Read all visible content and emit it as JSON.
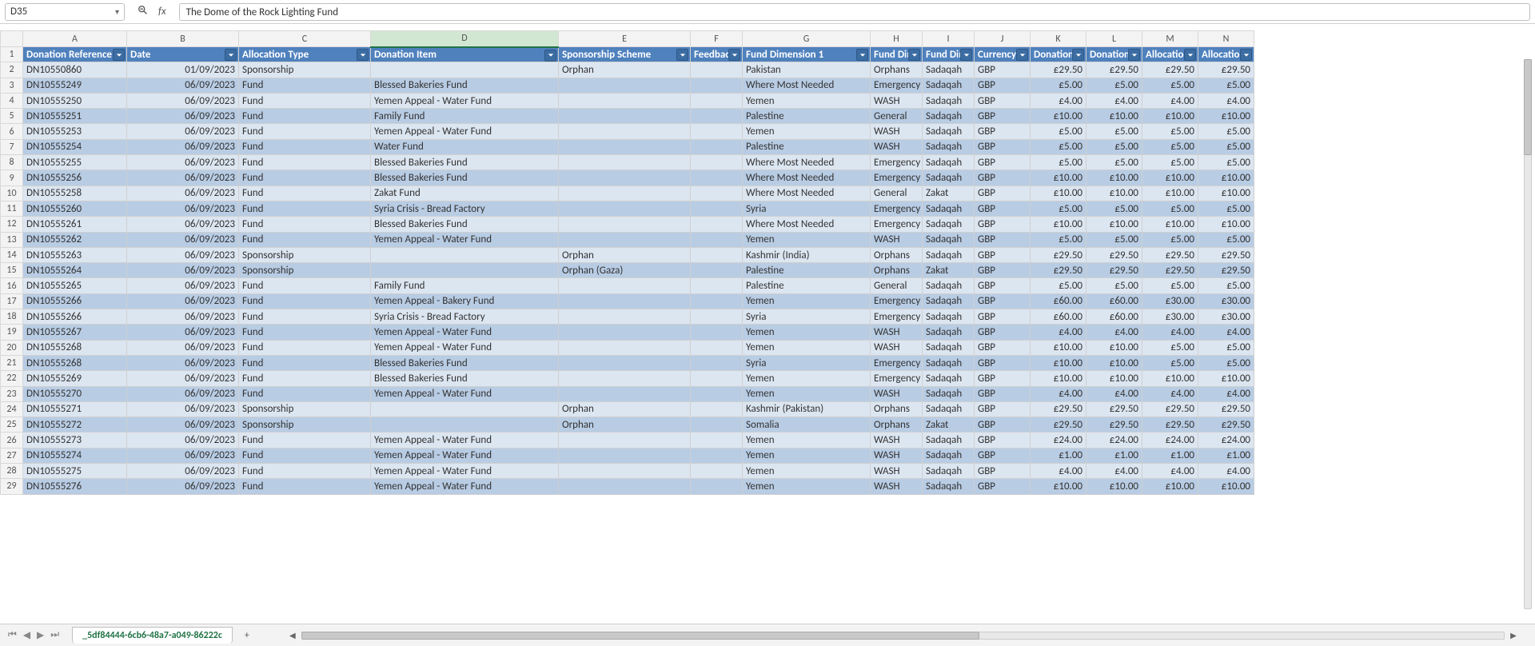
{
  "nameBox": {
    "cellRef": "D35"
  },
  "formulaBar": {
    "value": "The Dome of the Rock Lighting Fund"
  },
  "sheetTab": {
    "name": "_5df84444-6cb6-48a7-a049-86222c"
  },
  "columns": {
    "letters": [
      "A",
      "B",
      "C",
      "D",
      "E",
      "F",
      "G",
      "H",
      "I",
      "J",
      "K",
      "L",
      "M",
      "N"
    ],
    "widths": [
      130,
      140,
      165,
      235,
      165,
      65,
      160,
      65,
      65,
      70,
      70,
      70,
      70,
      70
    ],
    "selectedIndex": 3
  },
  "headers": [
    "Donation Reference",
    "Date",
    "Allocation Type",
    "Donation Item",
    "Sponsorship Scheme",
    "Feedback",
    "Fund Dimension 1",
    "Fund Dim",
    "Fund Dim",
    "Currency",
    "Donation",
    "Donation",
    "Allocation",
    "Allocation"
  ],
  "rows": [
    {
      "ref": "DN10550860",
      "date": "01/09/2023",
      "alloc": "Sponsorship",
      "item": "",
      "scheme": "Orphan",
      "fb": "",
      "fd1": "Pakistan",
      "fd2": "Orphans",
      "fd3": "Sadaqah",
      "cur": "GBP",
      "d1": "£29.50",
      "d2": "£29.50",
      "a1": "£29.50",
      "a2": "£29.50"
    },
    {
      "ref": "DN10555249",
      "date": "06/09/2023",
      "alloc": "Fund",
      "item": "Blessed Bakeries Fund",
      "scheme": "",
      "fb": "",
      "fd1": "Where Most Needed",
      "fd2": "Emergency",
      "fd3": "Sadaqah",
      "cur": "GBP",
      "d1": "£5.00",
      "d2": "£5.00",
      "a1": "£5.00",
      "a2": "£5.00"
    },
    {
      "ref": "DN10555250",
      "date": "06/09/2023",
      "alloc": "Fund",
      "item": "Yemen Appeal - Water Fund",
      "scheme": "",
      "fb": "",
      "fd1": "Yemen",
      "fd2": "WASH",
      "fd3": "Sadaqah",
      "cur": "GBP",
      "d1": "£4.00",
      "d2": "£4.00",
      "a1": "£4.00",
      "a2": "£4.00"
    },
    {
      "ref": "DN10555251",
      "date": "06/09/2023",
      "alloc": "Fund",
      "item": "Family Fund",
      "scheme": "",
      "fb": "",
      "fd1": "Palestine",
      "fd2": "General",
      "fd3": "Sadaqah",
      "cur": "GBP",
      "d1": "£10.00",
      "d2": "£10.00",
      "a1": "£10.00",
      "a2": "£10.00"
    },
    {
      "ref": "DN10555253",
      "date": "06/09/2023",
      "alloc": "Fund",
      "item": "Yemen Appeal - Water Fund",
      "scheme": "",
      "fb": "",
      "fd1": "Yemen",
      "fd2": "WASH",
      "fd3": "Sadaqah",
      "cur": "GBP",
      "d1": "£5.00",
      "d2": "£5.00",
      "a1": "£5.00",
      "a2": "£5.00"
    },
    {
      "ref": "DN10555254",
      "date": "06/09/2023",
      "alloc": "Fund",
      "item": "Water Fund",
      "scheme": "",
      "fb": "",
      "fd1": "Palestine",
      "fd2": "WASH",
      "fd3": "Sadaqah",
      "cur": "GBP",
      "d1": "£5.00",
      "d2": "£5.00",
      "a1": "£5.00",
      "a2": "£5.00"
    },
    {
      "ref": "DN10555255",
      "date": "06/09/2023",
      "alloc": "Fund",
      "item": "Blessed Bakeries Fund",
      "scheme": "",
      "fb": "",
      "fd1": "Where Most Needed",
      "fd2": "Emergency",
      "fd3": "Sadaqah",
      "cur": "GBP",
      "d1": "£5.00",
      "d2": "£5.00",
      "a1": "£5.00",
      "a2": "£5.00"
    },
    {
      "ref": "DN10555256",
      "date": "06/09/2023",
      "alloc": "Fund",
      "item": "Blessed Bakeries Fund",
      "scheme": "",
      "fb": "",
      "fd1": "Where Most Needed",
      "fd2": "Emergency",
      "fd3": "Sadaqah",
      "cur": "GBP",
      "d1": "£10.00",
      "d2": "£10.00",
      "a1": "£10.00",
      "a2": "£10.00"
    },
    {
      "ref": "DN10555258",
      "date": "06/09/2023",
      "alloc": "Fund",
      "item": "Zakat Fund",
      "scheme": "",
      "fb": "",
      "fd1": "Where Most Needed",
      "fd2": "General",
      "fd3": "Zakat",
      "cur": "GBP",
      "d1": "£10.00",
      "d2": "£10.00",
      "a1": "£10.00",
      "a2": "£10.00"
    },
    {
      "ref": "DN10555260",
      "date": "06/09/2023",
      "alloc": "Fund",
      "item": "Syria Crisis - Bread Factory",
      "scheme": "",
      "fb": "",
      "fd1": "Syria",
      "fd2": "Emergency",
      "fd3": "Sadaqah",
      "cur": "GBP",
      "d1": "£5.00",
      "d2": "£5.00",
      "a1": "£5.00",
      "a2": "£5.00"
    },
    {
      "ref": "DN10555261",
      "date": "06/09/2023",
      "alloc": "Fund",
      "item": "Blessed Bakeries Fund",
      "scheme": "",
      "fb": "",
      "fd1": "Where Most Needed",
      "fd2": "Emergency",
      "fd3": "Sadaqah",
      "cur": "GBP",
      "d1": "£10.00",
      "d2": "£10.00",
      "a1": "£10.00",
      "a2": "£10.00"
    },
    {
      "ref": "DN10555262",
      "date": "06/09/2023",
      "alloc": "Fund",
      "item": "Yemen Appeal - Water Fund",
      "scheme": "",
      "fb": "",
      "fd1": "Yemen",
      "fd2": "WASH",
      "fd3": "Sadaqah",
      "cur": "GBP",
      "d1": "£5.00",
      "d2": "£5.00",
      "a1": "£5.00",
      "a2": "£5.00"
    },
    {
      "ref": "DN10555263",
      "date": "06/09/2023",
      "alloc": "Sponsorship",
      "item": "",
      "scheme": "Orphan",
      "fb": "",
      "fd1": "Kashmir (India)",
      "fd2": "Orphans",
      "fd3": "Sadaqah",
      "cur": "GBP",
      "d1": "£29.50",
      "d2": "£29.50",
      "a1": "£29.50",
      "a2": "£29.50"
    },
    {
      "ref": "DN10555264",
      "date": "06/09/2023",
      "alloc": "Sponsorship",
      "item": "",
      "scheme": "Orphan (Gaza)",
      "fb": "",
      "fd1": "Palestine",
      "fd2": "Orphans",
      "fd3": "Zakat",
      "cur": "GBP",
      "d1": "£29.50",
      "d2": "£29.50",
      "a1": "£29.50",
      "a2": "£29.50"
    },
    {
      "ref": "DN10555265",
      "date": "06/09/2023",
      "alloc": "Fund",
      "item": "Family Fund",
      "scheme": "",
      "fb": "",
      "fd1": "Palestine",
      "fd2": "General",
      "fd3": "Sadaqah",
      "cur": "GBP",
      "d1": "£5.00",
      "d2": "£5.00",
      "a1": "£5.00",
      "a2": "£5.00"
    },
    {
      "ref": "DN10555266",
      "date": "06/09/2023",
      "alloc": "Fund",
      "item": "Yemen Appeal - Bakery Fund",
      "scheme": "",
      "fb": "",
      "fd1": "Yemen",
      "fd2": "Emergency",
      "fd3": "Sadaqah",
      "cur": "GBP",
      "d1": "£60.00",
      "d2": "£60.00",
      "a1": "£30.00",
      "a2": "£30.00"
    },
    {
      "ref": "DN10555266",
      "date": "06/09/2023",
      "alloc": "Fund",
      "item": "Syria Crisis - Bread Factory",
      "scheme": "",
      "fb": "",
      "fd1": "Syria",
      "fd2": "Emergency",
      "fd3": "Sadaqah",
      "cur": "GBP",
      "d1": "£60.00",
      "d2": "£60.00",
      "a1": "£30.00",
      "a2": "£30.00"
    },
    {
      "ref": "DN10555267",
      "date": "06/09/2023",
      "alloc": "Fund",
      "item": "Yemen Appeal - Water Fund",
      "scheme": "",
      "fb": "",
      "fd1": "Yemen",
      "fd2": "WASH",
      "fd3": "Sadaqah",
      "cur": "GBP",
      "d1": "£4.00",
      "d2": "£4.00",
      "a1": "£4.00",
      "a2": "£4.00"
    },
    {
      "ref": "DN10555268",
      "date": "06/09/2023",
      "alloc": "Fund",
      "item": "Yemen Appeal - Water Fund",
      "scheme": "",
      "fb": "",
      "fd1": "Yemen",
      "fd2": "WASH",
      "fd3": "Sadaqah",
      "cur": "GBP",
      "d1": "£10.00",
      "d2": "£10.00",
      "a1": "£5.00",
      "a2": "£5.00"
    },
    {
      "ref": "DN10555268",
      "date": "06/09/2023",
      "alloc": "Fund",
      "item": "Blessed Bakeries Fund",
      "scheme": "",
      "fb": "",
      "fd1": "Syria",
      "fd2": "Emergency",
      "fd3": "Sadaqah",
      "cur": "GBP",
      "d1": "£10.00",
      "d2": "£10.00",
      "a1": "£5.00",
      "a2": "£5.00"
    },
    {
      "ref": "DN10555269",
      "date": "06/09/2023",
      "alloc": "Fund",
      "item": "Blessed Bakeries Fund",
      "scheme": "",
      "fb": "",
      "fd1": "Yemen",
      "fd2": "Emergency",
      "fd3": "Sadaqah",
      "cur": "GBP",
      "d1": "£10.00",
      "d2": "£10.00",
      "a1": "£10.00",
      "a2": "£10.00"
    },
    {
      "ref": "DN10555270",
      "date": "06/09/2023",
      "alloc": "Fund",
      "item": "Yemen Appeal - Water Fund",
      "scheme": "",
      "fb": "",
      "fd1": "Yemen",
      "fd2": "WASH",
      "fd3": "Sadaqah",
      "cur": "GBP",
      "d1": "£4.00",
      "d2": "£4.00",
      "a1": "£4.00",
      "a2": "£4.00"
    },
    {
      "ref": "DN10555271",
      "date": "06/09/2023",
      "alloc": "Sponsorship",
      "item": "",
      "scheme": "Orphan",
      "fb": "",
      "fd1": "Kashmir (Pakistan)",
      "fd2": "Orphans",
      "fd3": "Sadaqah",
      "cur": "GBP",
      "d1": "£29.50",
      "d2": "£29.50",
      "a1": "£29.50",
      "a2": "£29.50"
    },
    {
      "ref": "DN10555272",
      "date": "06/09/2023",
      "alloc": "Sponsorship",
      "item": "",
      "scheme": "Orphan",
      "fb": "",
      "fd1": "Somalia",
      "fd2": "Orphans",
      "fd3": "Zakat",
      "cur": "GBP",
      "d1": "£29.50",
      "d2": "£29.50",
      "a1": "£29.50",
      "a2": "£29.50"
    },
    {
      "ref": "DN10555273",
      "date": "06/09/2023",
      "alloc": "Fund",
      "item": "Yemen Appeal - Water Fund",
      "scheme": "",
      "fb": "",
      "fd1": "Yemen",
      "fd2": "WASH",
      "fd3": "Sadaqah",
      "cur": "GBP",
      "d1": "£24.00",
      "d2": "£24.00",
      "a1": "£24.00",
      "a2": "£24.00"
    },
    {
      "ref": "DN10555274",
      "date": "06/09/2023",
      "alloc": "Fund",
      "item": "Yemen Appeal - Water Fund",
      "scheme": "",
      "fb": "",
      "fd1": "Yemen",
      "fd2": "WASH",
      "fd3": "Sadaqah",
      "cur": "GBP",
      "d1": "£1.00",
      "d2": "£1.00",
      "a1": "£1.00",
      "a2": "£1.00"
    },
    {
      "ref": "DN10555275",
      "date": "06/09/2023",
      "alloc": "Fund",
      "item": "Yemen Appeal - Water Fund",
      "scheme": "",
      "fb": "",
      "fd1": "Yemen",
      "fd2": "WASH",
      "fd3": "Sadaqah",
      "cur": "GBP",
      "d1": "£4.00",
      "d2": "£4.00",
      "a1": "£4.00",
      "a2": "£4.00"
    },
    {
      "ref": "DN10555276",
      "date": "06/09/2023",
      "alloc": "Fund",
      "item": "Yemen Appeal - Water Fund",
      "scheme": "",
      "fb": "",
      "fd1": "Yemen",
      "fd2": "WASH",
      "fd3": "Sadaqah",
      "cur": "GBP",
      "d1": "£10.00",
      "d2": "£10.00",
      "a1": "£10.00",
      "a2": "£10.00"
    }
  ]
}
